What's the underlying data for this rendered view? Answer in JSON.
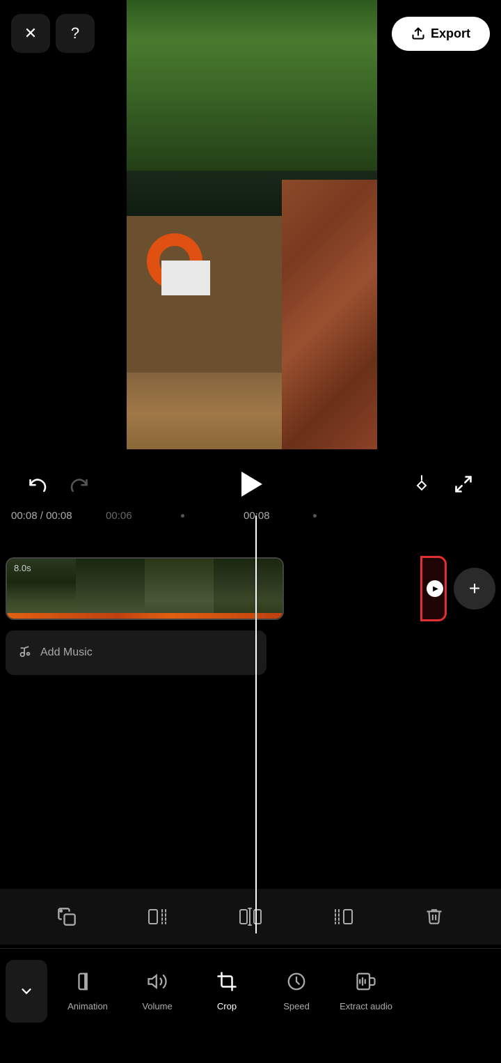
{
  "header": {
    "close_label": "✕",
    "help_label": "?",
    "export_label": "Export",
    "export_icon": "↑"
  },
  "playback": {
    "undo_icon": "↺",
    "redo_icon": "↻",
    "play_icon": "▶",
    "keyframe_icon": "+◇",
    "fullscreen_icon": "⬜"
  },
  "timeline": {
    "current_time": "00:08",
    "total_time": "00:08",
    "marker_06": "00:06",
    "marker_08": "00:08"
  },
  "video_strip": {
    "duration_label": "8.0s",
    "end_arrow": "▶"
  },
  "add_music": {
    "label": "Add Music",
    "icon": "♪+"
  },
  "clip_toolbar": {
    "copy_icon": "⧉",
    "split_left_icon": "|⧅",
    "split_icon": "⧅|⧅",
    "split_right_icon": "⧅|",
    "delete_icon": "🗑"
  },
  "bottom_nav": {
    "collapse_icon": "∨",
    "items": [
      {
        "id": "animation",
        "label": "Animation",
        "icon": "◱"
      },
      {
        "id": "volume",
        "label": "Volume",
        "icon": "🔊"
      },
      {
        "id": "crop",
        "label": "Crop",
        "icon": "⬚"
      },
      {
        "id": "speed",
        "label": "Speed",
        "icon": "⏱"
      },
      {
        "id": "extract-audio",
        "label": "Extract audio",
        "icon": "⬡"
      }
    ]
  },
  "colors": {
    "accent": "#e03030",
    "background": "#000000",
    "panel": "#111111",
    "text_primary": "#ffffff",
    "text_secondary": "#aaaaaa"
  }
}
